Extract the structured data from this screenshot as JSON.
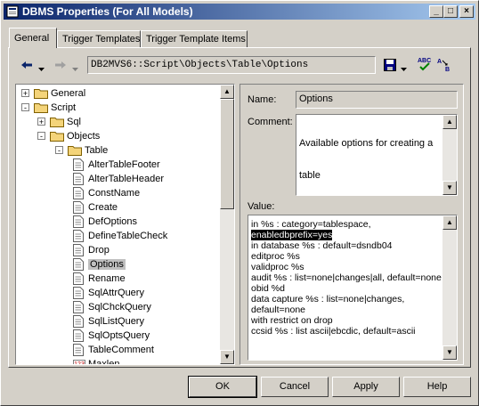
{
  "window": {
    "title": "DBMS Properties (For All Models)"
  },
  "title_buttons": {
    "minimize": "_",
    "maximize": "□",
    "close": "×"
  },
  "tabs": [
    {
      "label": "General"
    },
    {
      "label": "Trigger Templates"
    },
    {
      "label": "Trigger Template Items"
    }
  ],
  "toolbar": {
    "path": "DB2MVS6::Script\\Objects\\Table\\Options"
  },
  "tree": {
    "nodes": [
      {
        "label": "General",
        "type": "folder",
        "expander": "+"
      },
      {
        "label": "Script",
        "type": "folder",
        "expander": "-"
      },
      {
        "label": "Sql",
        "type": "folder",
        "expander": "+"
      },
      {
        "label": "Objects",
        "type": "folder",
        "expander": "-"
      },
      {
        "label": "Table",
        "type": "folder",
        "expander": "-"
      },
      {
        "label": "AlterTableFooter",
        "type": "doc"
      },
      {
        "label": "AlterTableHeader",
        "type": "doc"
      },
      {
        "label": "ConstName",
        "type": "doc"
      },
      {
        "label": "Create",
        "type": "doc"
      },
      {
        "label": "DefOptions",
        "type": "doc"
      },
      {
        "label": "DefineTableCheck",
        "type": "doc"
      },
      {
        "label": "Drop",
        "type": "doc"
      },
      {
        "label": "Options",
        "type": "doc"
      },
      {
        "label": "Rename",
        "type": "doc"
      },
      {
        "label": "SqlAttrQuery",
        "type": "doc"
      },
      {
        "label": "SqlChckQuery",
        "type": "doc"
      },
      {
        "label": "SqlListQuery",
        "type": "doc"
      },
      {
        "label": "SqlOptsQuery",
        "type": "doc"
      },
      {
        "label": "TableComment",
        "type": "doc"
      },
      {
        "label": "Maxlen",
        "type": "num",
        "icon_text": "123"
      }
    ]
  },
  "form": {
    "name_label": "Name:",
    "name_value": "Options",
    "comment_label": "Comment:",
    "comment_lines": [
      "Available options for creating a",
      "table"
    ],
    "value_label": "Value:",
    "value_lines": [
      "in %s : category=tablespace,",
      "enabledbprefix=yes",
      "in database %s : default=dsndb04",
      "editproc %s",
      "validproc %s",
      "audit %s : list=none|changes|all, default=none",
      "obid %d",
      "data capture %s : list=none|changes,",
      "default=none",
      "with restrict on drop",
      "ccsid %s : list ascii|ebcdic, default=ascii"
    ]
  },
  "buttons": {
    "ok": "OK",
    "cancel": "Cancel",
    "apply": "Apply",
    "help": "Help"
  }
}
